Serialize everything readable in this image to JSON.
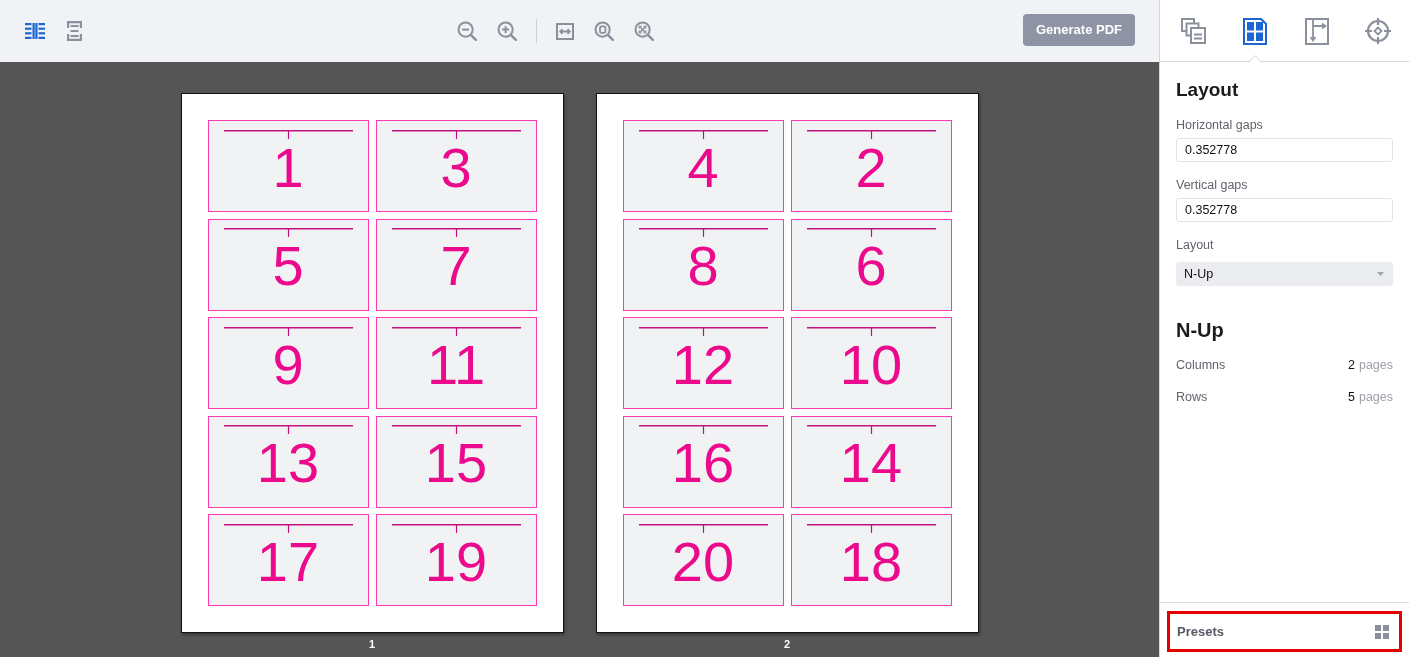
{
  "toolbar": {
    "view_modes": [
      {
        "selected": true
      },
      {
        "selected": false
      }
    ],
    "generate_button": {
      "label": "Generate PDF",
      "disabled": true
    }
  },
  "sheets": [
    {
      "label": "1",
      "tiles": [
        "1",
        "3",
        "5",
        "7",
        "9",
        "11",
        "13",
        "15",
        "17",
        "19"
      ]
    },
    {
      "label": "2",
      "tiles": [
        "4",
        "2",
        "8",
        "6",
        "12",
        "10",
        "16",
        "14",
        "20",
        "18"
      ]
    }
  ],
  "sidebar": {
    "tabs": [
      {
        "selected": false
      },
      {
        "selected": true
      },
      {
        "selected": false
      },
      {
        "selected": false
      }
    ],
    "layout_section": {
      "title": "Layout",
      "fields": [
        {
          "label": "Horizontal gaps",
          "value": "0.352778"
        },
        {
          "label": "Vertical gaps",
          "value": "0.352778"
        }
      ],
      "select": {
        "label": "Layout",
        "value": "N-Up"
      }
    },
    "nup_section": {
      "title": "N-Up",
      "rows": [
        {
          "label": "Columns",
          "value": "2",
          "unit": "pages"
        },
        {
          "label": "Rows",
          "value": "5",
          "unit": "pages"
        }
      ]
    },
    "presets": {
      "label": "Presets",
      "highlighted": true
    }
  }
}
